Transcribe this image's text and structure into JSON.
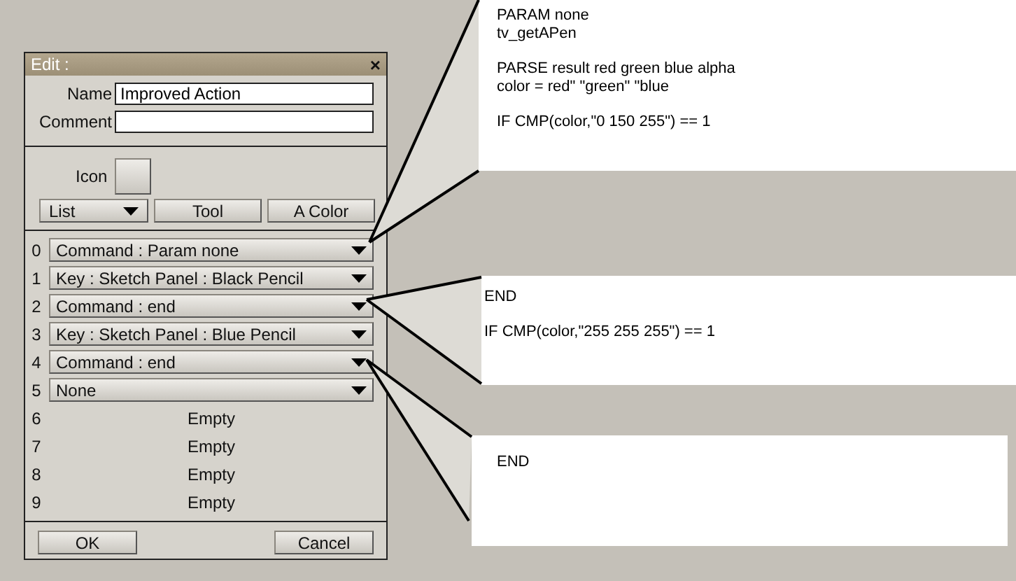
{
  "dialog": {
    "title": "Edit :",
    "close": "×",
    "fields": [
      {
        "label": "Name",
        "value": "Improved Action"
      },
      {
        "label": "Comment"
      }
    ],
    "icon_label": "Icon",
    "list_dropdown": "List",
    "buttons": [
      "Tool",
      "A Color"
    ],
    "slots": [
      {
        "index": "0",
        "kind": "combo",
        "text": "Command : Param none"
      },
      {
        "index": "1",
        "kind": "combo",
        "text": "Key : Sketch Panel : Black Pencil"
      },
      {
        "index": "2",
        "kind": "combo",
        "text": "Command : end"
      },
      {
        "index": "3",
        "kind": "combo",
        "text": "Key : Sketch Panel : Blue Pencil"
      },
      {
        "index": "4",
        "kind": "combo",
        "text": "Command : end"
      },
      {
        "index": "5",
        "kind": "combo",
        "text": "None"
      },
      {
        "index": "6",
        "kind": "empty",
        "text": "Empty"
      },
      {
        "index": "7",
        "kind": "empty",
        "text": "Empty"
      },
      {
        "index": "8",
        "kind": "empty",
        "text": "Empty"
      },
      {
        "index": "9",
        "kind": "empty",
        "text": "Empty"
      }
    ],
    "footer_buttons": [
      "OK",
      "Cancel"
    ]
  },
  "callouts": [
    {
      "paragraphs": [
        [
          "PARAM none",
          "tv_getAPen"
        ],
        [
          "PARSE result red green blue alpha",
          "color = red\" \"green\" \"blue"
        ],
        [
          "IF CMP(color,\"0 150 255\") == 1"
        ]
      ]
    },
    {
      "paragraphs": [
        [
          "END"
        ],
        [
          "IF CMP(color,\"255 255 255\") == 1"
        ]
      ]
    },
    {
      "paragraphs": [
        [
          "END"
        ]
      ]
    }
  ]
}
